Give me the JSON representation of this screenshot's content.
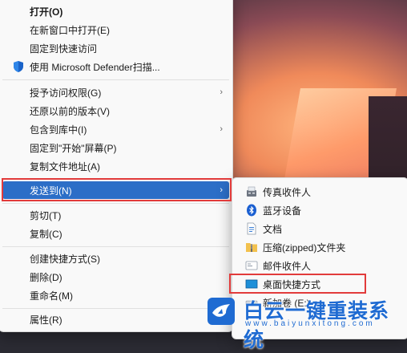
{
  "main_menu": {
    "items": [
      {
        "label": "打开(O)"
      },
      {
        "label": "在新窗口中打开(E)"
      },
      {
        "label": "固定到快速访问"
      },
      {
        "label": "使用 Microsoft Defender扫描..."
      },
      {
        "label": "授予访问权限(G)"
      },
      {
        "label": "还原以前的版本(V)"
      },
      {
        "label": "包含到库中(I)"
      },
      {
        "label": "固定到\"开始\"屏幕(P)"
      },
      {
        "label": "复制文件地址(A)"
      },
      {
        "label": "发送到(N)"
      },
      {
        "label": "剪切(T)"
      },
      {
        "label": "复制(C)"
      },
      {
        "label": "创建快捷方式(S)"
      },
      {
        "label": "删除(D)"
      },
      {
        "label": "重命名(M)"
      },
      {
        "label": "属性(R)"
      }
    ]
  },
  "send_to_menu": {
    "items": [
      {
        "label": "传真收件人"
      },
      {
        "label": "蓝牙设备"
      },
      {
        "label": "文档"
      },
      {
        "label": "压缩(zipped)文件夹"
      },
      {
        "label": "邮件收件人"
      },
      {
        "label": "桌面快捷方式"
      },
      {
        "label": "新加卷 (E:)"
      }
    ]
  },
  "watermark": {
    "brand": "白云一键重装系统",
    "url": "www.baiyunxitong.com"
  },
  "colors": {
    "highlight_box": "#e23b3b",
    "selection": "#2c6ec7",
    "watermark": "#1f6bd2"
  }
}
